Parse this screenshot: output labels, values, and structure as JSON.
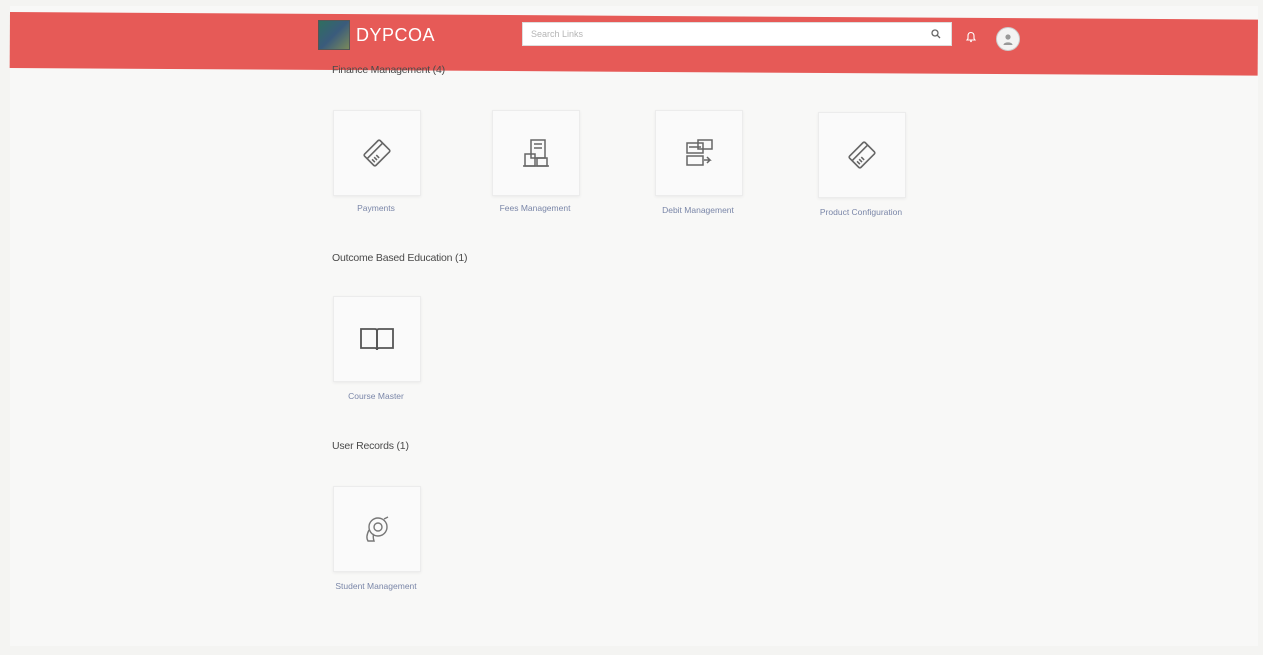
{
  "header": {
    "brand": "DYPCOA",
    "search": {
      "placeholder": "Search Links"
    },
    "icons": [
      "logo-icon",
      "search-icon",
      "bell-icon",
      "avatar"
    ]
  },
  "sections": [
    {
      "title": "Finance Management (4)",
      "tiles": [
        {
          "label": "Payments",
          "icon": "card-icon"
        },
        {
          "label": "Fees Management",
          "icon": "fees-icon"
        },
        {
          "label": "Debit Management",
          "icon": "debit-icon"
        },
        {
          "label": "Product Configuration",
          "icon": "card-icon"
        }
      ]
    },
    {
      "title": "Outcome Based Education (1)",
      "tiles": [
        {
          "label": "Course Master",
          "icon": "book-icon"
        }
      ]
    },
    {
      "title": "User Records (1)",
      "tiles": [
        {
          "label": "Student Management",
          "icon": "student-icon"
        }
      ]
    }
  ],
  "colors": {
    "topbar": "#e65a57",
    "label": "#7a86a8"
  }
}
